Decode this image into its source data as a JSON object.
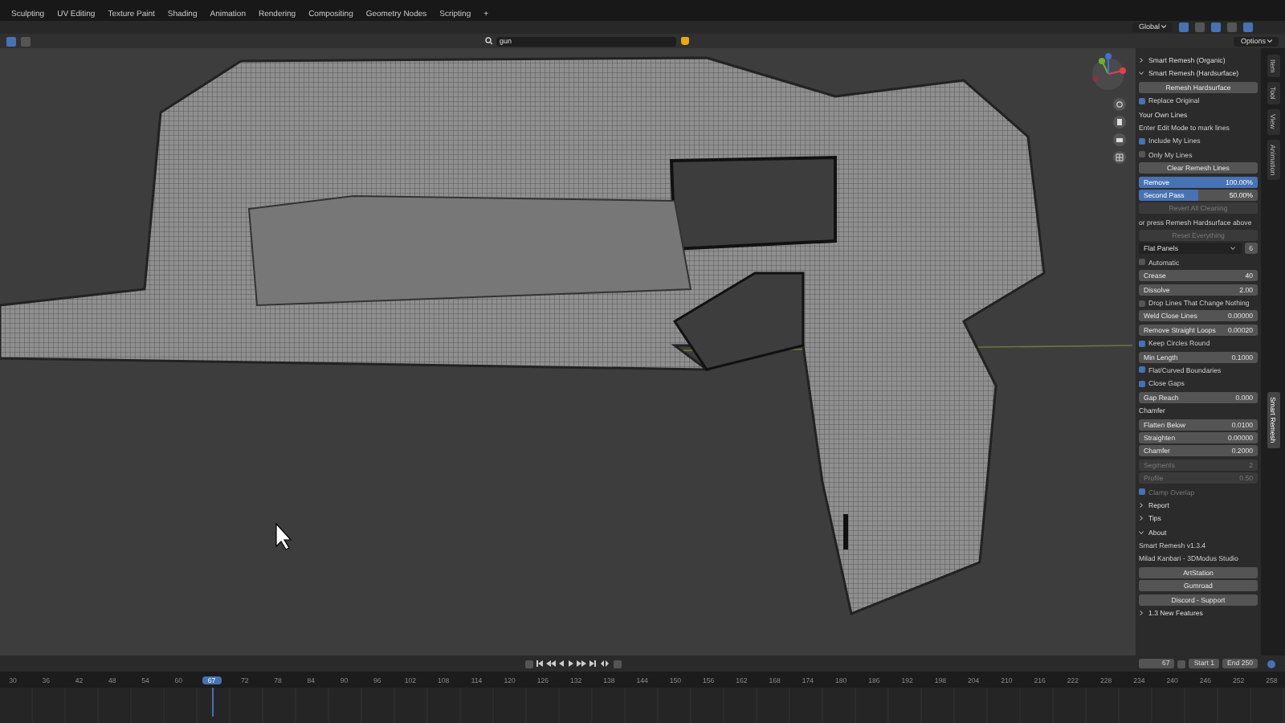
{
  "workspace_tabs": [
    {
      "label": "Sculpting",
      "selected": false
    },
    {
      "label": "UV Editing",
      "selected": false
    },
    {
      "label": "Texture Paint",
      "selected": false
    },
    {
      "label": "Shading",
      "selected": false
    },
    {
      "label": "Animation",
      "selected": false
    },
    {
      "label": "Rendering",
      "selected": false
    },
    {
      "label": "Compositing",
      "selected": false
    },
    {
      "label": "Geometry Nodes",
      "selected": false
    },
    {
      "label": "Scripting",
      "selected": false
    }
  ],
  "add_tab": "+",
  "header": {
    "orientation": "Global",
    "search_value": "gun",
    "options": "Options"
  },
  "side_panel": {
    "items": [
      {
        "kind": "section",
        "label": "Smart Remesh (Organic)",
        "expanded": false
      },
      {
        "kind": "section",
        "label": "Smart Remesh (Hardsurface)",
        "expanded": true
      },
      {
        "kind": "button",
        "label": "Remesh Hardsurface",
        "disabled": false
      },
      {
        "kind": "check",
        "label": "Replace Original",
        "checked": true,
        "disabled": false
      },
      {
        "kind": "heading",
        "label": "Your Own Lines"
      },
      {
        "kind": "note",
        "label": "Enter Edit Mode to mark lines"
      },
      {
        "kind": "check",
        "label": "Include My Lines",
        "checked": true,
        "disabled": false
      },
      {
        "kind": "check",
        "label": "Only My Lines",
        "checked": false,
        "disabled": false
      },
      {
        "kind": "button",
        "label": "Clear Remesh Lines",
        "disabled": false
      },
      {
        "kind": "slider",
        "label": "Remove",
        "value": "100.00%",
        "level": 1
      },
      {
        "kind": "slider",
        "label": "Second Pass",
        "value": "50.00%",
        "level": 0.5
      },
      {
        "kind": "button",
        "label": "Revert All Cleaning",
        "disabled": true
      },
      {
        "kind": "note",
        "label": "or press Remesh Hardsurface above"
      },
      {
        "kind": "button",
        "label": "Reset Everything",
        "disabled": true
      },
      {
        "kind": "dropdown",
        "label": "Flat Panels",
        "value": "6"
      },
      {
        "kind": "check",
        "label": "Automatic",
        "checked": false,
        "disabled": false
      },
      {
        "kind": "field",
        "label": "Crease",
        "value": "40",
        "disabled": false
      },
      {
        "kind": "field",
        "label": "Dissolve",
        "value": "2.00",
        "disabled": false
      },
      {
        "kind": "check",
        "label": "Drop Lines That Change Nothing",
        "checked": false,
        "disabled": false
      },
      {
        "kind": "field",
        "label": "Weld Close Lines",
        "value": "0.00000",
        "disabled": false
      },
      {
        "kind": "field",
        "label": "Remove Straight Loops",
        "value": "0.00020",
        "disabled": false
      },
      {
        "kind": "check",
        "label": "Keep Circles Round",
        "checked": true,
        "disabled": false
      },
      {
        "kind": "field",
        "label": "Min Length",
        "value": "0.1000",
        "disabled": false
      },
      {
        "kind": "check",
        "label": "Flat/Curved Boundaries",
        "checked": true,
        "disabled": false
      },
      {
        "kind": "check",
        "label": "Close Gaps",
        "checked": true,
        "disabled": false
      },
      {
        "kind": "field",
        "label": "Gap Reach",
        "value": "0.000",
        "disabled": false
      },
      {
        "kind": "heading",
        "label": "Chamfer"
      },
      {
        "kind": "field",
        "label": "Flatten Below",
        "value": "0.0100",
        "disabled": false
      },
      {
        "kind": "field",
        "label": "Straighten",
        "value": "0.00000",
        "disabled": false
      },
      {
        "kind": "field",
        "label": "Chamfer",
        "value": "0.2000",
        "disabled": false
      },
      {
        "kind": "field",
        "label": "Segments",
        "value": "2",
        "disabled": true
      },
      {
        "kind": "field",
        "label": "Profile",
        "value": "0.50",
        "disabled": true
      },
      {
        "kind": "check",
        "label": "Clamp Overlap",
        "checked": true,
        "disabled": true
      },
      {
        "kind": "section",
        "label": "Report",
        "expanded": false
      },
      {
        "kind": "section",
        "label": "Tips",
        "expanded": false
      },
      {
        "kind": "section",
        "label": "About",
        "expanded": true
      },
      {
        "kind": "note",
        "label": "Smart Remesh v1.3.4"
      },
      {
        "kind": "note",
        "label": "Milad Kanbari - 3DModus Studio"
      },
      {
        "kind": "button",
        "label": "ArtStation",
        "disabled": false
      },
      {
        "kind": "button",
        "label": "Gumroad",
        "disabled": false
      },
      {
        "kind": "button",
        "label": "Discord - Support",
        "disabled": false
      },
      {
        "kind": "section",
        "label": "1.3 New Features",
        "expanded": false
      }
    ]
  },
  "side_tabs": [
    {
      "label": "Item",
      "selected": false
    },
    {
      "label": "Tool",
      "selected": false
    },
    {
      "label": "View",
      "selected": false
    },
    {
      "label": "Animation",
      "selected": false
    },
    {
      "label": "Smart Remesh",
      "selected": true
    }
  ],
  "timeline": {
    "current_frame": "67",
    "start_label": "Start",
    "start": "1",
    "end_label": "End",
    "end": "250",
    "ticks": [
      "30",
      "36",
      "42",
      "48",
      "54",
      "60",
      "67",
      "72",
      "78",
      "84",
      "90",
      "96",
      "102",
      "108",
      "114",
      "120",
      "126",
      "132",
      "138",
      "144",
      "150",
      "156",
      "162",
      "168",
      "174",
      "180",
      "186",
      "192",
      "198",
      "204",
      "210",
      "216",
      "222",
      "228",
      "234",
      "240",
      "246",
      "252",
      "258"
    ]
  }
}
